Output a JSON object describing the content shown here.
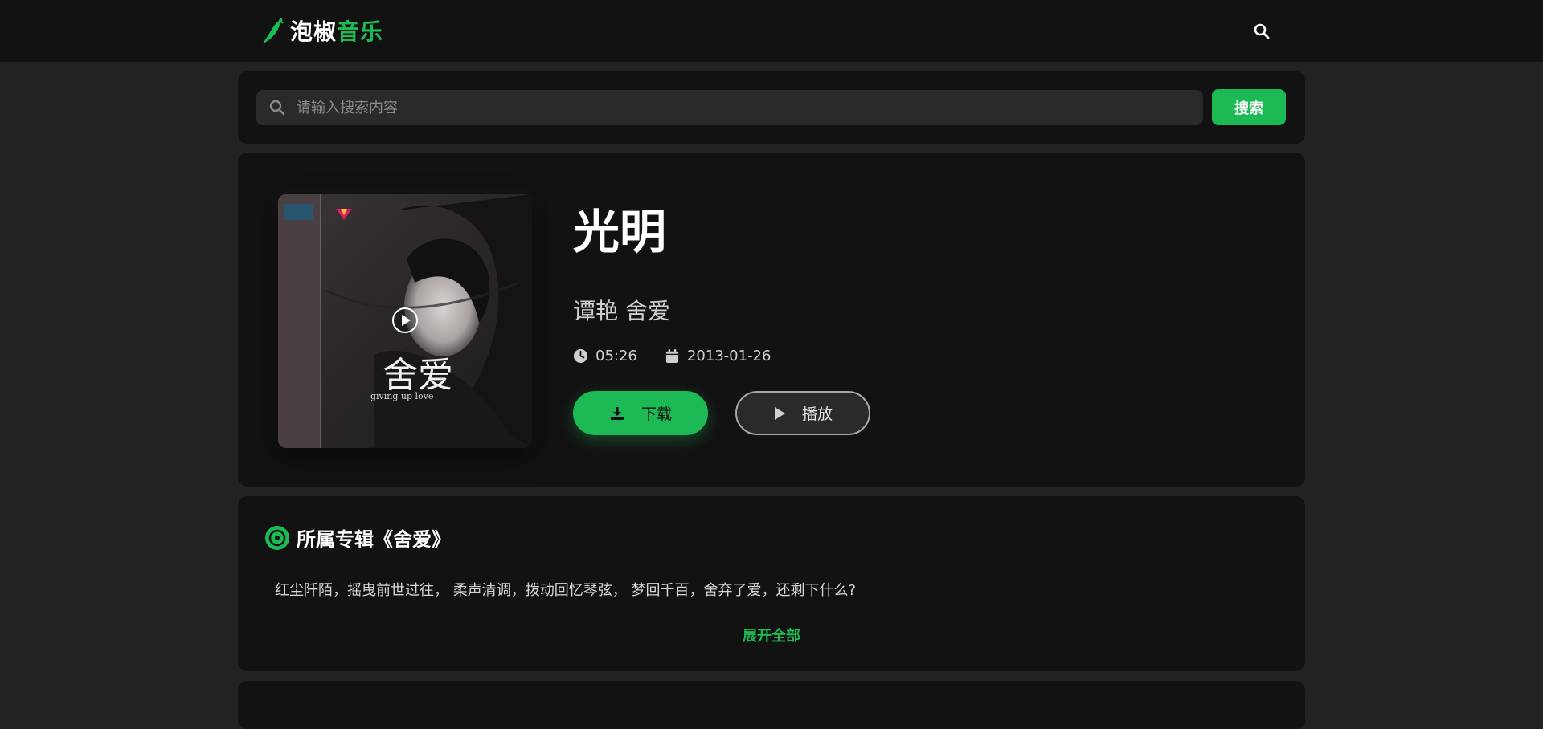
{
  "header": {
    "logo_part1": "泡椒",
    "logo_part2": "音乐",
    "search_icon": "search-icon"
  },
  "search": {
    "placeholder": "请输入搜索内容",
    "button_label": "搜索"
  },
  "song": {
    "title": "光明",
    "artist": "谭艳 舍爱",
    "duration": "05:26",
    "release_date": "2013-01-26",
    "download_label": "下载",
    "play_label": "播放"
  },
  "album": {
    "title": "所属专辑《舍爱》",
    "description": "红尘阡陌，摇曳前世过往， 柔声清调，拨动回忆琴弦， 梦回千百，舍弃了爱，还剩下什么?",
    "expand_label": "展开全部"
  },
  "colors": {
    "accent": "#1db954",
    "panel": "#121212",
    "background": "#222222"
  }
}
